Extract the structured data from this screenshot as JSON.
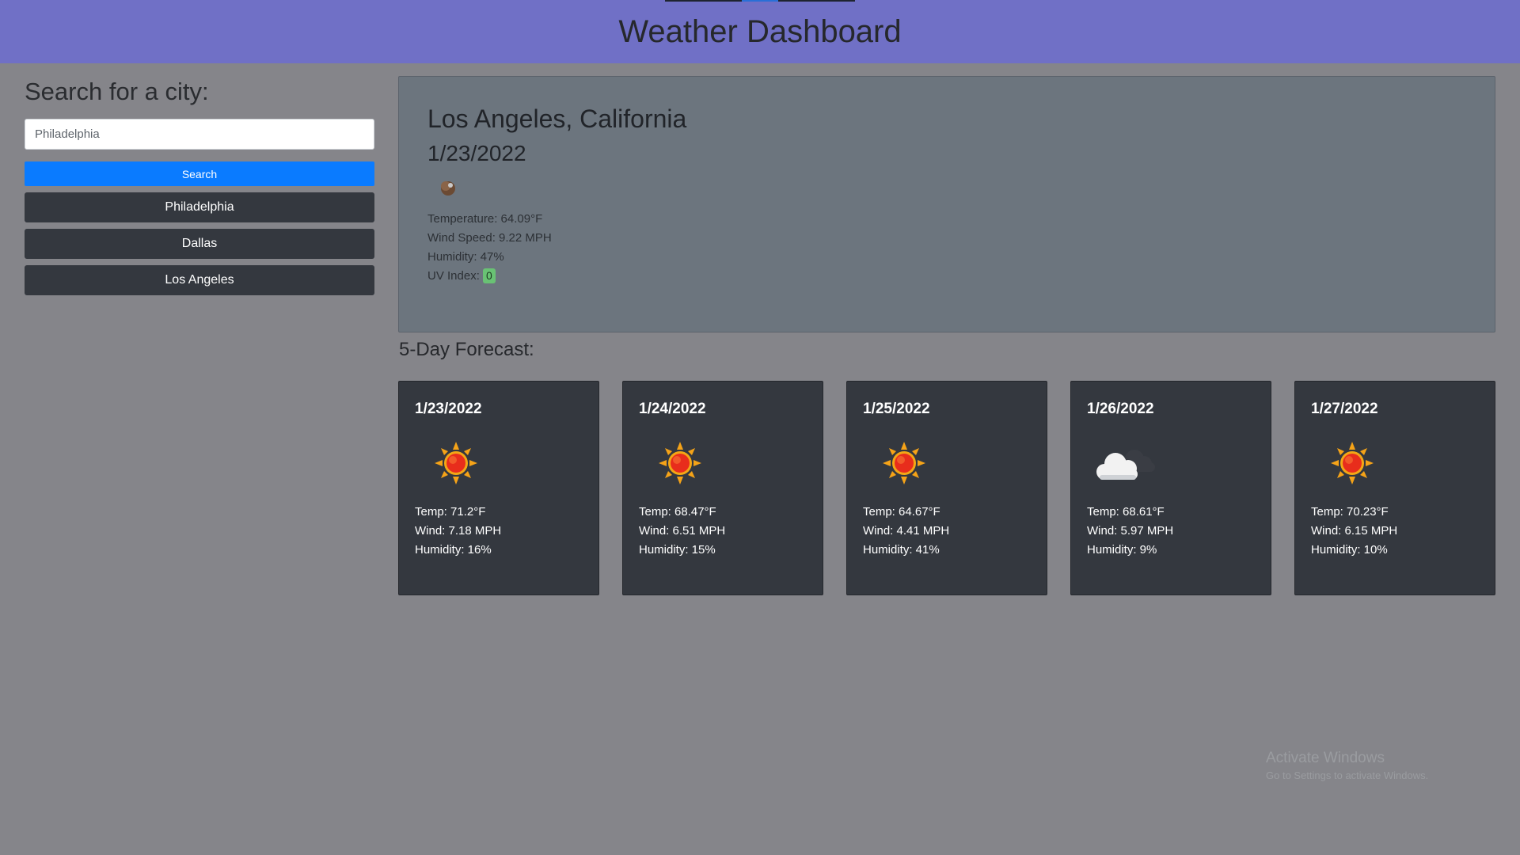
{
  "header": {
    "title": "Weather Dashboard"
  },
  "sidebar": {
    "heading": "Search for a city:",
    "search_value": "Philadelphia",
    "search_button": "Search",
    "history": [
      "Philadelphia",
      "Dallas",
      "Los Angeles"
    ]
  },
  "current": {
    "city": "Los Angeles, California",
    "date": "1/23/2022",
    "icon": "moon-icon",
    "temperature": "Temperature: 64.09°F",
    "wind": "Wind Speed: 9.22 MPH",
    "humidity": "Humidity: 47%",
    "uv_label": "UV Index: ",
    "uv_value": "0",
    "uv_color": "#69c274"
  },
  "forecast": {
    "heading": "5-Day Forecast:",
    "days": [
      {
        "date": "1/23/2022",
        "icon": "sun-icon",
        "temp": "Temp: 71.2°F",
        "wind": "Wind: 7.18 MPH",
        "humidity": "Humidity: 16%"
      },
      {
        "date": "1/24/2022",
        "icon": "sun-icon",
        "temp": "Temp: 68.47°F",
        "wind": "Wind: 6.51 MPH",
        "humidity": "Humidity: 15%"
      },
      {
        "date": "1/25/2022",
        "icon": "sun-icon",
        "temp": "Temp: 64.67°F",
        "wind": "Wind: 4.41 MPH",
        "humidity": "Humidity: 41%"
      },
      {
        "date": "1/26/2022",
        "icon": "cloud-icon",
        "temp": "Temp: 68.61°F",
        "wind": "Wind: 5.97 MPH",
        "humidity": "Humidity: 9%"
      },
      {
        "date": "1/27/2022",
        "icon": "sun-icon",
        "temp": "Temp: 70.23°F",
        "wind": "Wind: 6.15 MPH",
        "humidity": "Humidity: 10%"
      }
    ]
  },
  "watermark": {
    "title": "Activate Windows",
    "subtitle": "Go to Settings to activate Windows."
  },
  "colors": {
    "header_bg": "#7070c6",
    "page_bg": "#85858a",
    "search_button": "#0a7bff",
    "dark_card": "#34383f",
    "current_card": "#6c757e"
  }
}
